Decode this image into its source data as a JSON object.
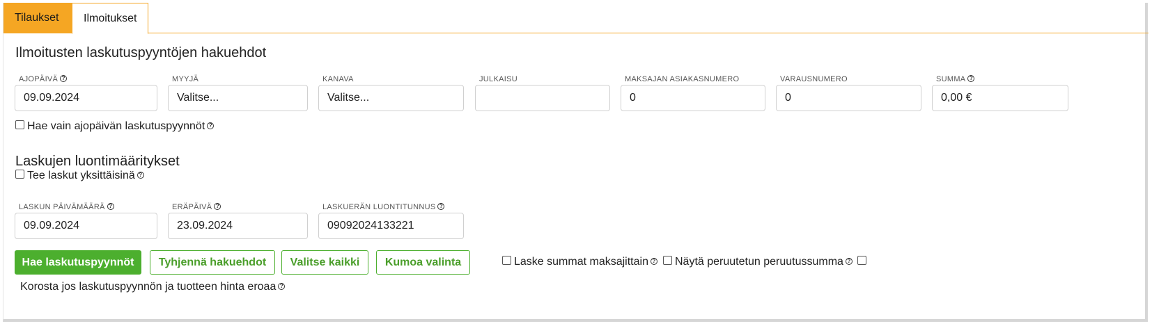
{
  "tabs": [
    {
      "label": "Tilaukset"
    },
    {
      "label": "Ilmoitukset"
    }
  ],
  "search_section": {
    "title": "Ilmoitusten laskutuspyyntöjen hakuehdot",
    "fields": {
      "ajopaiva": {
        "label": "AJOPÄIVÄ",
        "value": "09.09.2024"
      },
      "myyja": {
        "label": "MYYJÄ",
        "value": "Valitse..."
      },
      "kanava": {
        "label": "KANAVA",
        "value": "Valitse..."
      },
      "julkaisu": {
        "label": "JULKAISU",
        "value": ""
      },
      "maksajan_asiakasnumero": {
        "label": "MAKSAJAN ASIAKASNUMERO",
        "value": "0"
      },
      "varausnumero": {
        "label": "VARAUSNUMERO",
        "value": "0"
      },
      "summa": {
        "label": "SUMMA",
        "value": "0,00 €"
      }
    },
    "only_run_date_checkbox": {
      "label": "Hae vain ajopäivän laskutuspyynnöt",
      "checked": false
    }
  },
  "create_section": {
    "title": "Laskujen luontimääritykset",
    "individual_invoices_checkbox": {
      "label": "Tee laskut yksittäisinä",
      "checked": false
    },
    "fields": {
      "laskun_paivamaara": {
        "label": "LASKUN PÄIVÄMÄÄRÄ",
        "value": "09.09.2024"
      },
      "erapaiva": {
        "label": "ERÄPÄIVÄ",
        "value": "23.09.2024"
      },
      "laskueran_luontitunnus": {
        "label": "LASKUERÄN LUONTITUNNUS",
        "value": "09092024133221"
      }
    }
  },
  "actions": {
    "fetch": "Hae laskutuspyynnöt",
    "clear": "Tyhjennä hakuehdot",
    "select_all": "Valitse kaikki",
    "unselect": "Kumoa valinta"
  },
  "options": {
    "sum_by_payer": {
      "label": "Laske summat maksajittain",
      "checked": false
    },
    "show_cancel_sum": {
      "label": "Näytä peruutetun peruutussumma",
      "checked": false
    },
    "highlight_price_diff": {
      "label": "Korosta jos laskutuspyynnön ja tuotteen hinta eroaa",
      "checked": false
    }
  },
  "help_glyph": "?",
  "colors": {
    "accent": "#f5a623",
    "primary_button": "#4caf2e"
  }
}
